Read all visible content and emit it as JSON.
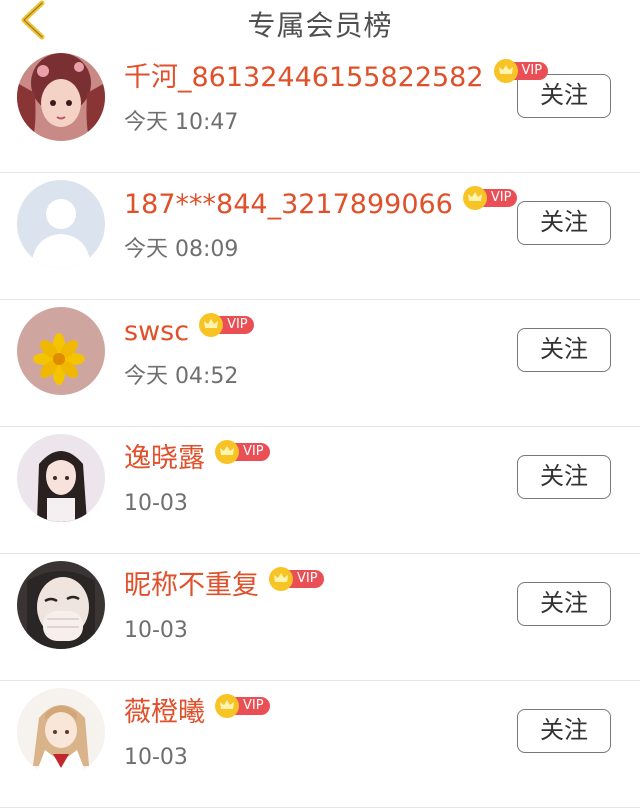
{
  "header": {
    "title": "专属会员榜",
    "back_icon": "chevron-left-icon",
    "back_color": "#f2c230"
  },
  "colors": {
    "name": "#e0502a",
    "vip_badge": "#ea4f55",
    "crown": "#f7c325"
  },
  "members": [
    {
      "name": "千河_86132446155822582",
      "time": "今天 10:47",
      "vip": "VIP",
      "follow": "关注",
      "avatar": "anime-girl-avatar"
    },
    {
      "name": "187***844_3217899066",
      "time": "今天 08:09",
      "vip": "VIP",
      "follow": "关注",
      "avatar": "default-person-avatar"
    },
    {
      "name": "swsc",
      "time": "今天 04:52",
      "vip": "VIP",
      "follow": "关注",
      "avatar": "yellow-flower-avatar"
    },
    {
      "name": "逸晓露",
      "time": "10-03",
      "vip": "VIP",
      "follow": "关注",
      "avatar": "girl-photo-avatar"
    },
    {
      "name": "昵称不重复",
      "time": "10-03",
      "vip": "VIP",
      "follow": "关注",
      "avatar": "face-hand-avatar"
    },
    {
      "name": "薇橙曦",
      "time": "10-03",
      "vip": "VIP",
      "follow": "关注",
      "avatar": "anime-sailor-avatar"
    }
  ]
}
